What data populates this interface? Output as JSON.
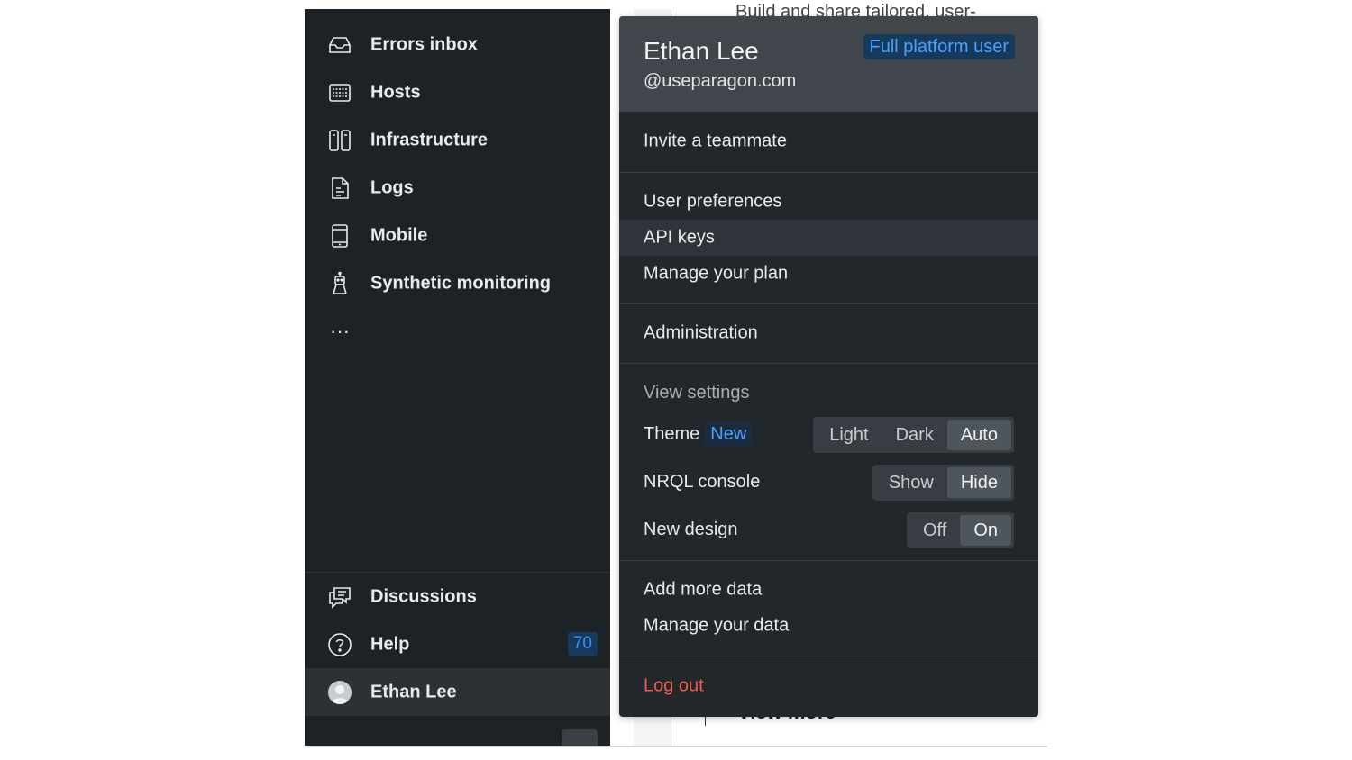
{
  "sidebar": {
    "items": [
      {
        "label": "Errors inbox",
        "icon": "inbox-icon"
      },
      {
        "label": "Hosts",
        "icon": "hosts-icon"
      },
      {
        "label": "Infrastructure",
        "icon": "infrastructure-icon"
      },
      {
        "label": "Logs",
        "icon": "logs-icon"
      },
      {
        "label": "Mobile",
        "icon": "mobile-icon"
      },
      {
        "label": "Synthetic monitoring",
        "icon": "synthetic-monitoring-icon"
      }
    ],
    "more": "···",
    "bottom": {
      "discussions": "Discussions",
      "help": "Help",
      "help_badge": "70",
      "user": "Ethan Lee"
    }
  },
  "background": {
    "top_text": "Build and share tailored, user-",
    "bottom_text": "View more"
  },
  "menu": {
    "user_name": "Ethan Lee",
    "user_email": "@useparagon.com",
    "role_badge": "Full platform user",
    "invite": "Invite a teammate",
    "user_preferences": "User preferences",
    "api_keys": "API keys",
    "manage_plan": "Manage your plan",
    "administration": "Administration",
    "view_settings": "View settings",
    "theme": {
      "label": "Theme",
      "badge": "New",
      "options": [
        "Light",
        "Dark",
        "Auto"
      ],
      "selected": "Auto"
    },
    "nrql_console": {
      "label": "NRQL console",
      "options": [
        "Show",
        "Hide"
      ],
      "selected": "Hide"
    },
    "new_design": {
      "label": "New design",
      "options": [
        "Off",
        "On"
      ],
      "selected": "On"
    },
    "add_more_data": "Add more data",
    "manage_data": "Manage your data",
    "log_out": "Log out"
  },
  "colors": {
    "sidebar_bg": "#1d2226",
    "menu_bg": "#22272b",
    "menu_header_bg": "#40464b",
    "accent_blue": "#4ea0ff",
    "logout_red": "#ef5b4c"
  }
}
